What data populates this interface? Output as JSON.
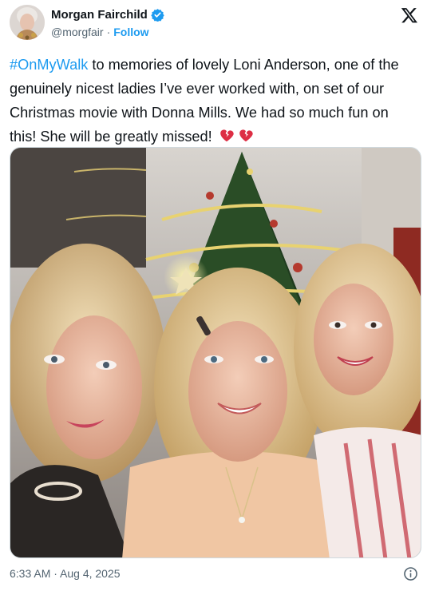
{
  "author": {
    "name": "Morgan Fairchild",
    "handle": "@morgfair",
    "separator": "·",
    "follow_label": "Follow",
    "verified": true
  },
  "tweet": {
    "hashtag": "#OnMyWalk",
    "text": " to memories of lovely Loni Anderson, one of the genuinely nicest ladies I’ve ever worked with, on set of our Christmas movie with Donna Mills. We had so much fun on this! She will be greatly missed!",
    "emojis": [
      "broken-heart-icon",
      "broken-heart-icon"
    ]
  },
  "footer": {
    "timestamp": "6:33 AM · Aug 4, 2025"
  },
  "colors": {
    "accent": "#1d9bf0",
    "text": "#0f1419",
    "muted": "#536471",
    "border": "#cfd9de"
  }
}
